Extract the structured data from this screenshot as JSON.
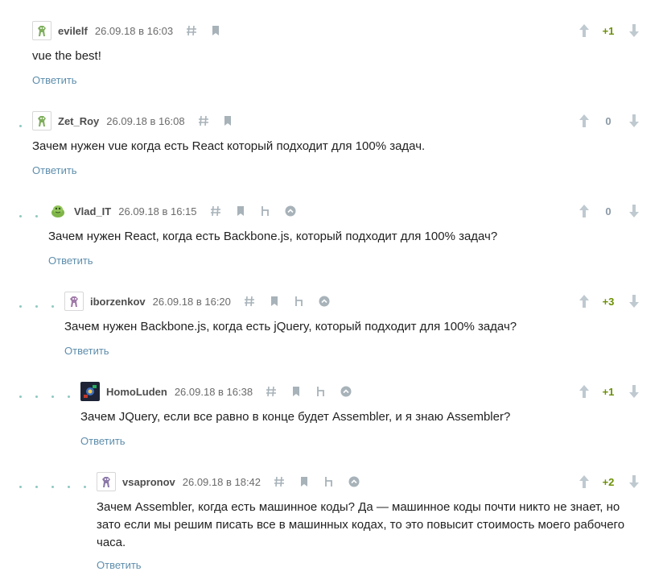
{
  "comments": [
    {
      "username": "evilelf",
      "datetime": "26.09.18 в 16:03",
      "text": "vue the best!",
      "reply_label": "Ответить",
      "score": "+1",
      "avatar_icon": "green-robot-avatar-icon",
      "actions": [
        "hash-link-icon",
        "bookmark-icon"
      ]
    },
    {
      "username": "Zet_Roy",
      "datetime": "26.09.18 в 16:08",
      "text": "Зачем нужен vue когда есть React который подходит для 100% задач.",
      "reply_label": "Ответить",
      "score": "0",
      "avatar_icon": "green-robot-avatar-icon",
      "actions": [
        "hash-link-icon",
        "bookmark-icon"
      ]
    },
    {
      "username": "Vlad_IT",
      "datetime": "26.09.18 в 16:15",
      "text": "Зачем нужен React, когда есть Backbone.js, который подходит для 100% задач?",
      "reply_label": "Ответить",
      "score": "0",
      "avatar_icon": "green-monster-avatar-icon",
      "actions": [
        "hash-link-icon",
        "bookmark-icon",
        "parent-link-icon",
        "collapse-up-icon"
      ]
    },
    {
      "username": "iborzenkov",
      "datetime": "26.09.18 в 16:20",
      "text": "Зачем нужен Backbone.js, когда есть jQuery, который подходит для 100% задач?",
      "reply_label": "Ответить",
      "score": "+3",
      "avatar_icon": "purple-robot-avatar-icon",
      "actions": [
        "hash-link-icon",
        "bookmark-icon",
        "parent-link-icon",
        "collapse-up-icon"
      ]
    },
    {
      "username": "HomoLuden",
      "datetime": "26.09.18 в 16:38",
      "text": "Зачем JQuery, если все равно в конце будет Assembler, и я знаю Assembler?",
      "reply_label": "Ответить",
      "score": "+1",
      "avatar_icon": "dark-game-avatar-icon",
      "actions": [
        "hash-link-icon",
        "bookmark-icon",
        "parent-link-icon",
        "collapse-up-icon"
      ]
    },
    {
      "username": "vsapronov",
      "datetime": "26.09.18 в 18:42",
      "text_lines": [
        "Зачем Assembler, когда есть машинное коды? Да — машинное коды почти никто не знает, но",
        "зато если мы решим писать все в машинных кодах, то это повысит стоимость моего рабочего",
        "часа."
      ],
      "reply_label": "Ответить",
      "score": "+2",
      "avatar_icon": "purple-robot-avatar-icon",
      "actions": [
        "hash-link-icon",
        "bookmark-icon",
        "parent-link-icon",
        "collapse-up-icon"
      ]
    }
  ],
  "colors": {
    "positive_score": "#6c9007",
    "neutral_score": "#8a9aa6",
    "reply_link": "#5e8eac",
    "thread_dots": "#8ec9c1"
  }
}
